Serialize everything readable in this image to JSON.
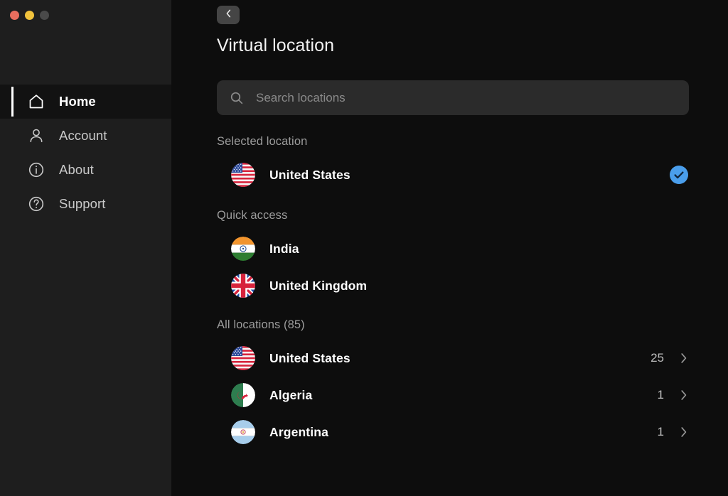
{
  "window": {
    "controls": [
      {
        "name": "close",
        "color": "#ea6e5e"
      },
      {
        "name": "minimize",
        "color": "#f0c23c"
      },
      {
        "name": "maximize",
        "color": "#4a4a4a"
      }
    ]
  },
  "sidebar": {
    "items": [
      {
        "label": "Home",
        "icon": "home-icon",
        "active": true
      },
      {
        "label": "Account",
        "icon": "person-icon",
        "active": false
      },
      {
        "label": "About",
        "icon": "info-icon",
        "active": false
      },
      {
        "label": "Support",
        "icon": "question-icon",
        "active": false
      }
    ]
  },
  "header": {
    "back_icon": "chevron-left-icon",
    "title": "Virtual location"
  },
  "search": {
    "icon": "search-icon",
    "placeholder": "Search locations",
    "value": ""
  },
  "selected_section": {
    "heading": "Selected location",
    "item": {
      "name": "United States",
      "flag": "us-flag",
      "check_icon": "check-circle-icon",
      "check_color": "#4a9eeb"
    }
  },
  "quick_access": {
    "heading": "Quick access",
    "items": [
      {
        "name": "India",
        "flag": "in-flag"
      },
      {
        "name": "United Kingdom",
        "flag": "gb-flag"
      }
    ]
  },
  "all_locations": {
    "heading": "All locations (85)",
    "count": 85,
    "items": [
      {
        "name": "United States",
        "flag": "us-flag",
        "count": "25",
        "chevron": "chevron-right-icon"
      },
      {
        "name": "Algeria",
        "flag": "dz-flag",
        "count": "1",
        "chevron": "chevron-right-icon"
      },
      {
        "name": "Argentina",
        "flag": "ar-flag",
        "count": "1",
        "chevron": "chevron-right-icon"
      }
    ]
  }
}
